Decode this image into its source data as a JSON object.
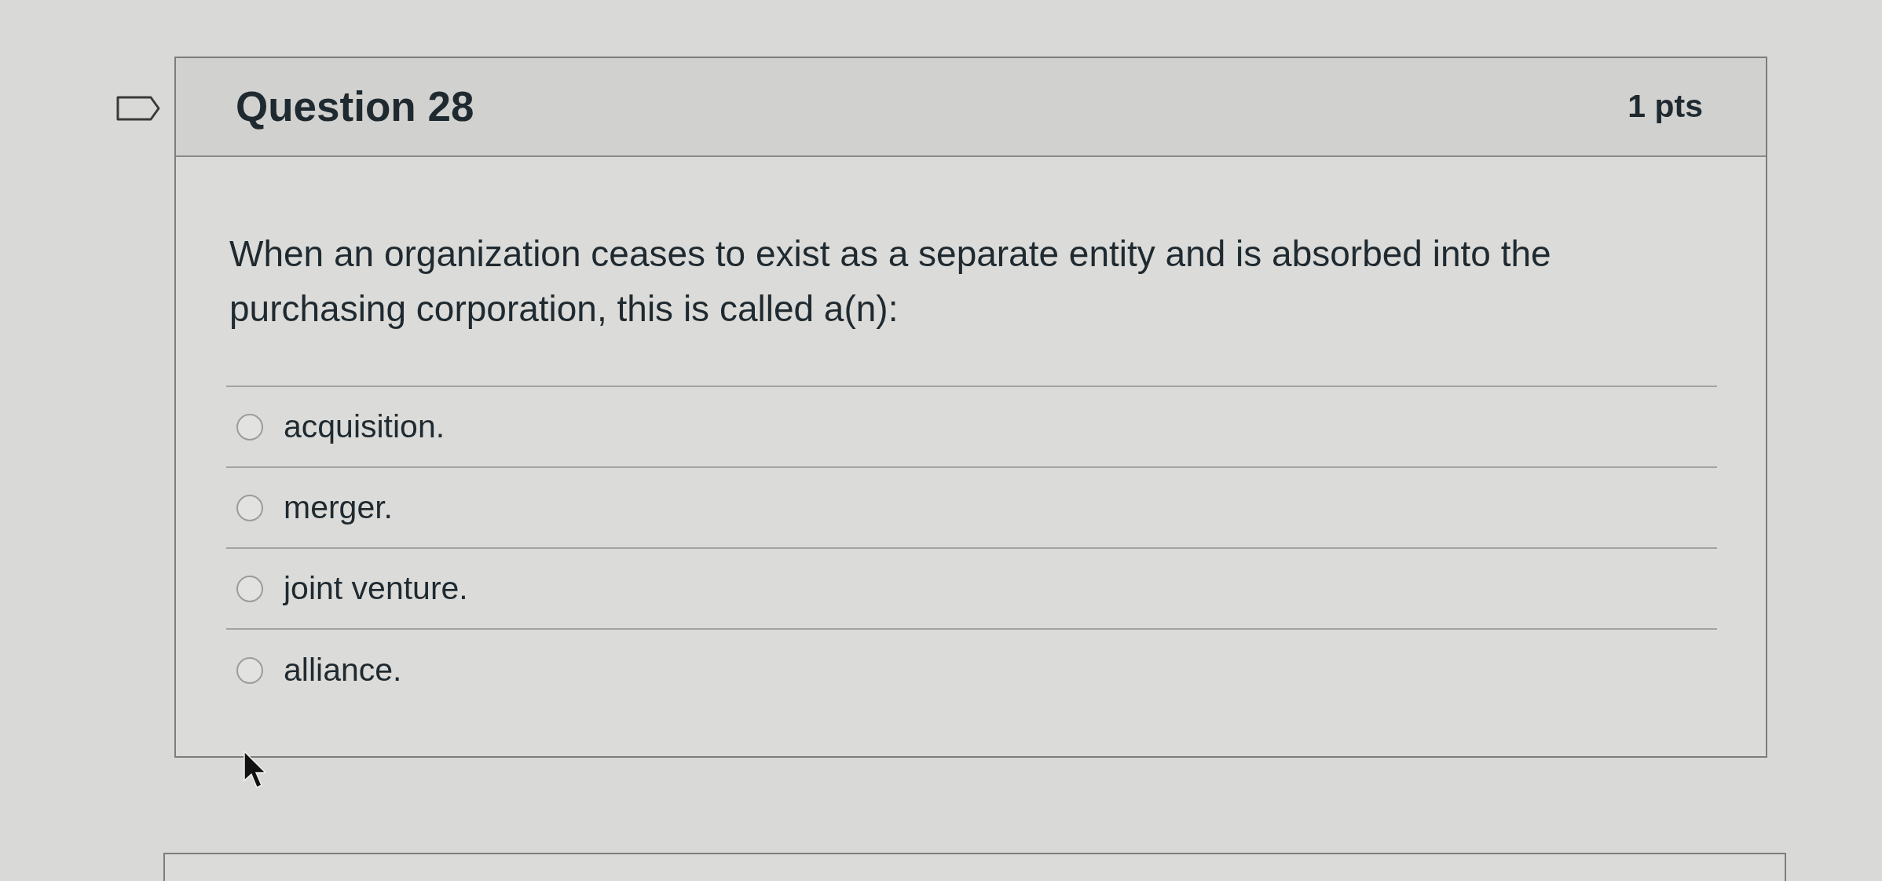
{
  "question": {
    "flagged": false,
    "title": "Question 28",
    "points": "1 pts",
    "text": "When an organization ceases to exist as a separate entity and is absorbed into the purchasing corporation, this is called a(n):",
    "answers": [
      {
        "label": "acquisition.",
        "selected": false
      },
      {
        "label": "merger.",
        "selected": false
      },
      {
        "label": "joint venture.",
        "selected": false
      },
      {
        "label": "alliance.",
        "selected": false
      }
    ]
  }
}
